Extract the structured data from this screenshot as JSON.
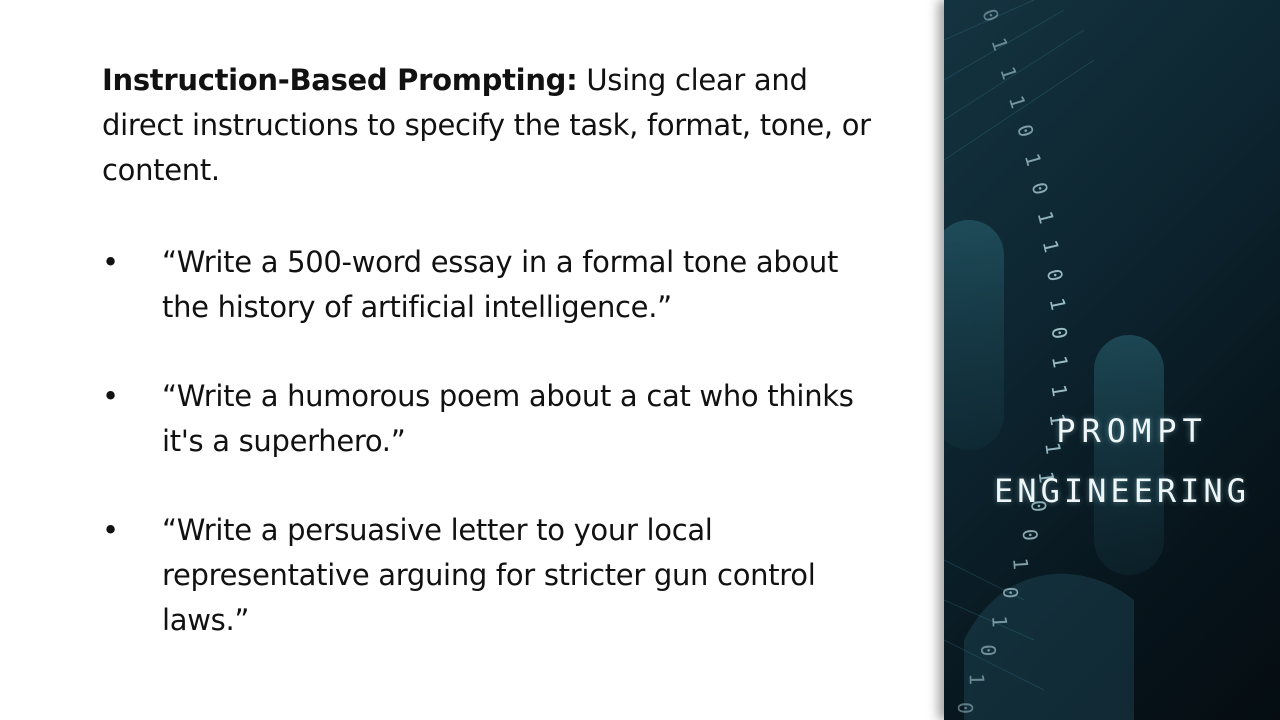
{
  "intro": {
    "bold": "Instruction-Based Prompting:",
    "rest": " Using clear and direct instructions to specify the task, format, tone, or content."
  },
  "bullets": [
    {
      "marker": "•",
      "text": "“Write a 500-word essay in a formal tone about the history of artificial intelligence.”"
    },
    {
      "marker": "•",
      "text": "“Write a humorous poem about a cat who thinks it's a superhero.”"
    },
    {
      "marker": "•",
      "text": "“Write a persuasive letter to your local representative arguing for stricter gun control laws.”"
    }
  ],
  "panel": {
    "line1": "PROMPT",
    "line2": "ENGINEERING",
    "binary_digits": "0111010110101111100101010"
  },
  "colors": {
    "panel_dark": "#07141b",
    "panel_accent": "#1d4a5a",
    "text": "#111111"
  }
}
